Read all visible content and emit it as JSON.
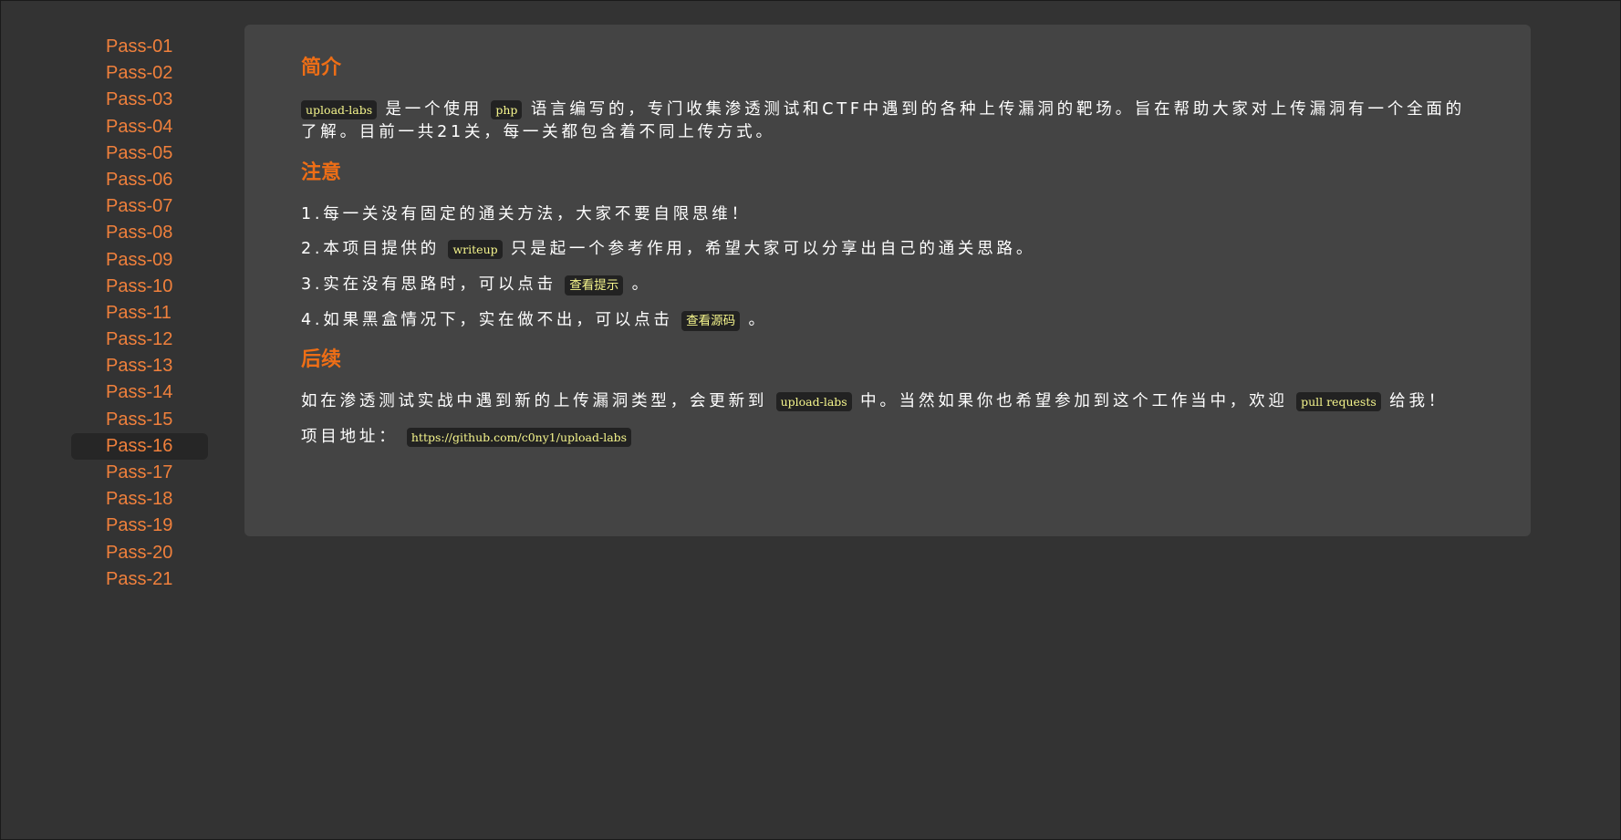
{
  "sidebar": {
    "items": [
      {
        "label": "Pass-01"
      },
      {
        "label": "Pass-02"
      },
      {
        "label": "Pass-03"
      },
      {
        "label": "Pass-04"
      },
      {
        "label": "Pass-05"
      },
      {
        "label": "Pass-06"
      },
      {
        "label": "Pass-07"
      },
      {
        "label": "Pass-08"
      },
      {
        "label": "Pass-09"
      },
      {
        "label": "Pass-10"
      },
      {
        "label": "Pass-11"
      },
      {
        "label": "Pass-12"
      },
      {
        "label": "Pass-13"
      },
      {
        "label": "Pass-14"
      },
      {
        "label": "Pass-15"
      },
      {
        "label": "Pass-16"
      },
      {
        "label": "Pass-17"
      },
      {
        "label": "Pass-18"
      },
      {
        "label": "Pass-19"
      },
      {
        "label": "Pass-20"
      },
      {
        "label": "Pass-21"
      }
    ],
    "active": "Pass-16"
  },
  "intro": {
    "title": "简介",
    "code_name": "upload-labs",
    "t1": "是一个使用",
    "code_lang": "php",
    "t2": "语言编写的，专门收集渗透测试和CTF中遇到的各种上传漏洞的靶场。旨在帮助大家对上传漏洞有一个全面的了解。目前一共21关，每一关都包含着不同上传方式。"
  },
  "notice": {
    "title": "注意",
    "item1": "1.每一关没有固定的通关方法，大家不要自限思维！",
    "item2_pre": "2.本项目提供的",
    "item2_code": "writeup",
    "item2_post": "只是起一个参考作用，希望大家可以分享出自己的通关思路。",
    "item3_pre": "3.实在没有思路时，可以点击",
    "item3_code": "查看提示",
    "item3_post": "。",
    "item4_pre": "4.如果黑盒情况下，实在做不出，可以点击",
    "item4_code": "查看源码",
    "item4_post": "。"
  },
  "followup": {
    "title": "后续",
    "pre": "如在渗透测试实战中遇到新的上传漏洞类型，会更新到",
    "code1": "upload-labs",
    "mid": "中。当然如果你也希望参加到这个工作当中，欢迎",
    "code2": "pull requests",
    "post": "给我！",
    "addr_label": "项目地址：",
    "addr_url": "https://github.com/c0ny1/upload-labs"
  },
  "colors": {
    "background": "#333333",
    "panel": "#444444",
    "link": "#f0803c",
    "heading": "#ee6e16",
    "code_text": "#f5f58c",
    "code_bg": "#222222"
  }
}
